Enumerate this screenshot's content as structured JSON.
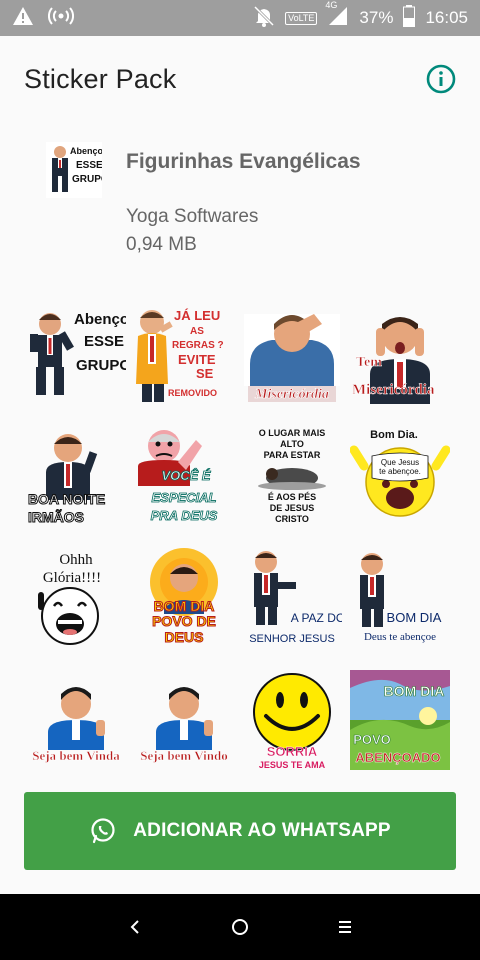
{
  "status_bar": {
    "battery_percent": "37%",
    "time": "16:05",
    "network": "4G",
    "volte": "VoLTE"
  },
  "app_bar": {
    "title": "Sticker Pack"
  },
  "pack": {
    "name": "Figurinhas Evangélicas",
    "publisher": "Yoga Softwares",
    "size": "0,94 MB",
    "thumb_text": [
      "Abençoa",
      "ESSE",
      "GRUPO"
    ]
  },
  "stickers": [
    {
      "text": [
        "Abençoa",
        "ESSE",
        "GRUPO"
      ]
    },
    {
      "text": [
        "JÁ LEU",
        "AS",
        "REGRAS ?",
        "EVITE",
        "SE",
        "REMOVIDO"
      ]
    },
    {
      "text": [
        "Misericórdia"
      ]
    },
    {
      "text": [
        "Tem",
        "Misericórdia"
      ]
    },
    {
      "text": [
        "BOA NOITE",
        "IRMÃOS"
      ]
    },
    {
      "text": [
        "VOCÊ É",
        "ESPECIAL",
        "PRA DEUS"
      ]
    },
    {
      "text": [
        "O LUGAR MAIS",
        "ALTO",
        "PARA ESTAR",
        "É AOS PÉS",
        "DE JESUS",
        "CRISTO"
      ]
    },
    {
      "text": [
        "Bom Dia.",
        "Que Jesus",
        "te abençoe."
      ]
    },
    {
      "text": [
        "Ohhh",
        "Glória!!!!"
      ]
    },
    {
      "text": [
        "BOM DIA",
        "POVO DE",
        "DEUS"
      ]
    },
    {
      "text": [
        "A PAZ DO",
        "SENHOR JESUS"
      ]
    },
    {
      "text": [
        "BOM DIA",
        "Deus te abençoe"
      ]
    },
    {
      "text": [
        "Seja bem Vinda"
      ]
    },
    {
      "text": [
        "Seja bem Vindo"
      ]
    },
    {
      "text": [
        "SORRIA",
        "JESUS TE AMA"
      ]
    },
    {
      "text": [
        "BOM DIA",
        "POVO",
        "ABENÇOADO"
      ]
    }
  ],
  "add_button": {
    "label": "ADICIONAR AO WHATSAPP"
  },
  "colors": {
    "accent_green": "#43a047",
    "info_teal": "#00897b",
    "status_bar": "#9e9e9e"
  }
}
